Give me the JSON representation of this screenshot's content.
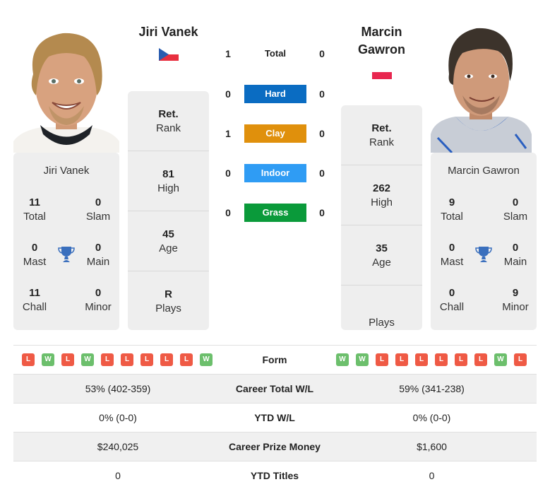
{
  "colors": {
    "hard": "#0a6cc2",
    "clay": "#e0900c",
    "indoor": "#2f9cf4",
    "grass": "#0a9a3a",
    "win": "#6cbf6c",
    "loss": "#ef5a45",
    "trophy": "#3a6fbd"
  },
  "player1": {
    "name": "Jiri Vanek",
    "country_flag": "czech-republic-flag",
    "card_name": "Jiri Vanek",
    "rank": {
      "value": "Ret.",
      "label": "Rank"
    },
    "high": {
      "value": "81",
      "label": "High"
    },
    "age": {
      "value": "45",
      "label": "Age"
    },
    "plays": {
      "value": "R",
      "label": "Plays"
    },
    "titles": {
      "total": {
        "value": "11",
        "label": "Total"
      },
      "slam": {
        "value": "0",
        "label": "Slam"
      },
      "mast": {
        "value": "0",
        "label": "Mast"
      },
      "main": {
        "value": "0",
        "label": "Main"
      },
      "chall": {
        "value": "11",
        "label": "Chall"
      },
      "minor": {
        "value": "0",
        "label": "Minor"
      }
    },
    "form": [
      "L",
      "W",
      "L",
      "W",
      "L",
      "L",
      "L",
      "L",
      "L",
      "W"
    ]
  },
  "player2": {
    "name": "Marcin Gawron",
    "name_line1": "Marcin",
    "name_line2": "Gawron",
    "country_flag": "poland-flag",
    "card_name": "Marcin Gawron",
    "rank": {
      "value": "Ret.",
      "label": "Rank"
    },
    "high": {
      "value": "262",
      "label": "High"
    },
    "age": {
      "value": "35",
      "label": "Age"
    },
    "plays": {
      "value": "",
      "label": "Plays"
    },
    "titles": {
      "total": {
        "value": "9",
        "label": "Total"
      },
      "slam": {
        "value": "0",
        "label": "Slam"
      },
      "mast": {
        "value": "0",
        "label": "Mast"
      },
      "main": {
        "value": "0",
        "label": "Main"
      },
      "chall": {
        "value": "0",
        "label": "Chall"
      },
      "minor": {
        "value": "9",
        "label": "Minor"
      }
    },
    "form": [
      "W",
      "W",
      "L",
      "L",
      "L",
      "L",
      "L",
      "L",
      "W",
      "L"
    ]
  },
  "h2h": [
    {
      "label": "Total",
      "p1": "1",
      "p2": "0",
      "surface": "total"
    },
    {
      "label": "Hard",
      "p1": "0",
      "p2": "0",
      "surface": "hard"
    },
    {
      "label": "Clay",
      "p1": "1",
      "p2": "0",
      "surface": "clay"
    },
    {
      "label": "Indoor",
      "p1": "0",
      "p2": "0",
      "surface": "indoor"
    },
    {
      "label": "Grass",
      "p1": "0",
      "p2": "0",
      "surface": "grass"
    }
  ],
  "table": {
    "form_label": "Form",
    "rows": [
      {
        "label": "Career Total W/L",
        "p1": "53% (402-359)",
        "p2": "59% (341-238)"
      },
      {
        "label": "YTD W/L",
        "p1": "0% (0-0)",
        "p2": "0% (0-0)"
      },
      {
        "label": "Career Prize Money",
        "p1": "$240,025",
        "p2": "$1,600"
      },
      {
        "label": "YTD Titles",
        "p1": "0",
        "p2": "0"
      }
    ]
  }
}
